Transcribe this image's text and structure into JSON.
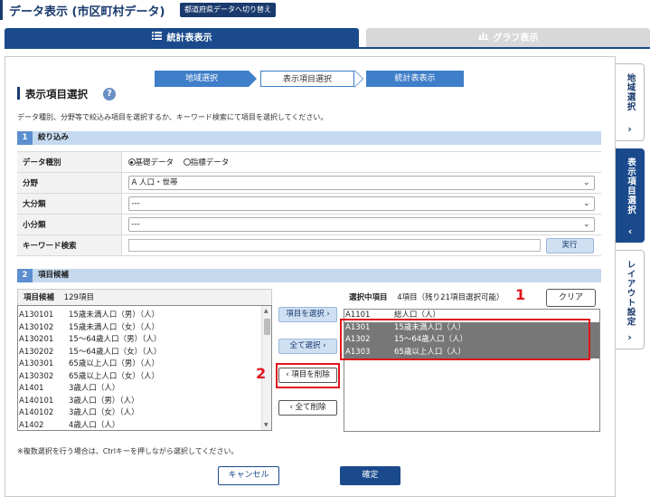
{
  "header": {
    "title": "データ表示 (市区町村データ)",
    "switch_label": "都道府県データへ切り替え"
  },
  "tabs": {
    "table_label": "統計表表示",
    "graph_label": "グラフ表示"
  },
  "steps": [
    "地域選択",
    "表示項目選択",
    "統計表表示"
  ],
  "section": {
    "title": "表示項目選択",
    "help": "?",
    "description": "データ種別、分野等で絞込み項目を選択するか、キーワード検索にて項目を選択してください。"
  },
  "filter": {
    "num": "1",
    "header": "絞り込み",
    "data_type_label": "データ種別",
    "radio_basic": "基礎データ",
    "radio_index": "指標データ",
    "field_label": "分野",
    "field_value": "A 人口・世帯",
    "major_label": "大分類",
    "major_value": "---",
    "minor_label": "小分類",
    "minor_value": "---",
    "keyword_label": "キーワード検索",
    "exec_label": "実行"
  },
  "candidates": {
    "num": "2",
    "header": "項目候補",
    "list_title": "項目候補",
    "count": "129項目",
    "items": [
      {
        "code": "A130101",
        "name": "15歳未満人口（男）（人）"
      },
      {
        "code": "A130102",
        "name": "15歳未満人口（女）（人）"
      },
      {
        "code": "A130201",
        "name": "15～64歳人口（男）（人）"
      },
      {
        "code": "A130202",
        "name": "15～64歳人口（女）（人）"
      },
      {
        "code": "A130301",
        "name": "65歳以上人口（男）（人）"
      },
      {
        "code": "A130302",
        "name": "65歳以上人口（女）（人）"
      },
      {
        "code": "A1401",
        "name": "3歳人口（人）"
      },
      {
        "code": "A140101",
        "name": "3歳人口（男）（人）"
      },
      {
        "code": "A140102",
        "name": "3歳人口（女）（人）"
      },
      {
        "code": "A1402",
        "name": "4歳人口（人）"
      }
    ]
  },
  "middle_buttons": {
    "add": "項目を選択 ›",
    "add_all": "全て選択 ›",
    "remove": "‹ 項目を削除",
    "remove_all": "‹ 全て削除"
  },
  "selected": {
    "title": "選択中項目",
    "count": "4項目（残り21項目選択可能）",
    "clear_label": "クリア",
    "items": [
      {
        "code": "A1101",
        "name": "総人口（人）",
        "highlighted": false
      },
      {
        "code": "A1301",
        "name": "15歳未満人口（人）",
        "highlighted": true
      },
      {
        "code": "A1302",
        "name": "15～64歳人口（人）",
        "highlighted": true
      },
      {
        "code": "A1303",
        "name": "65歳以上人口（人）",
        "highlighted": true
      }
    ]
  },
  "annotations": {
    "label_1": "1",
    "label_2": "2"
  },
  "footer": {
    "note": "※複数選択を行う場合は、Ctrlキーを押しながら選択してください。",
    "cancel": "キャンセル",
    "ok": "確定"
  },
  "side_tabs": [
    "地域選択",
    "表示項目選択",
    "レイアウト設定"
  ],
  "colors": {
    "primary": "#1a4a8c",
    "step": "#3f7ec8",
    "highlight": "#e0161c"
  }
}
